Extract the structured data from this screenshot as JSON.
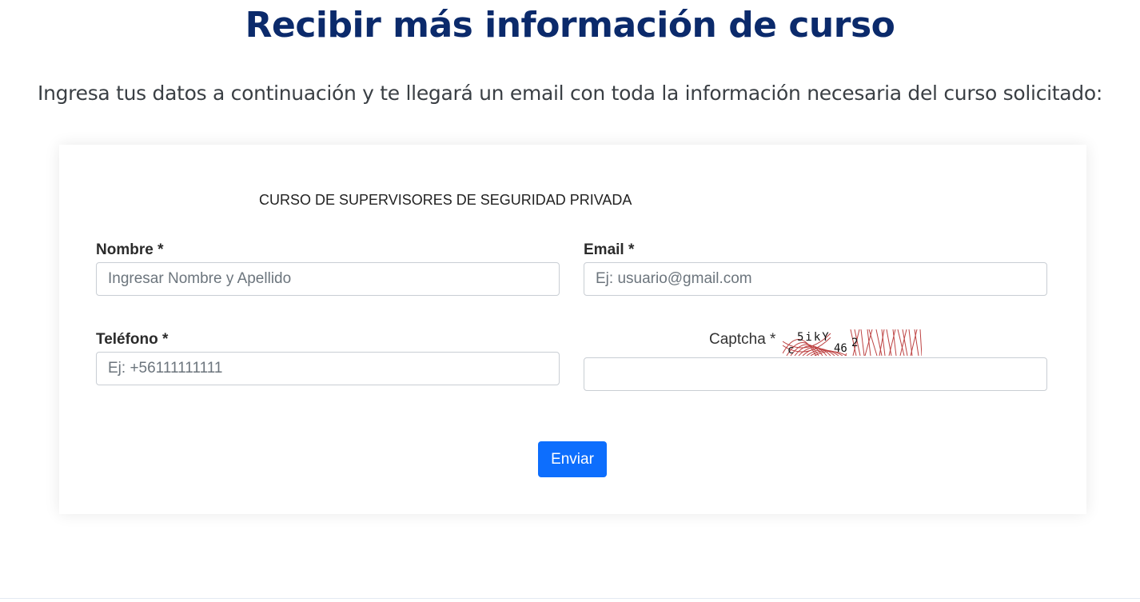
{
  "page": {
    "title": "Recibir más información de curso",
    "subtitle": "Ingresa tus datos a continuación y te llegará un email con toda la información necesaria del curso solicitado:"
  },
  "form": {
    "course_name": "CURSO DE SUPERVISORES DE SEGURIDAD PRIVADA",
    "name_label": "Nombre *",
    "name_value": "",
    "name_placeholder": "Ingresar Nombre y Apellido",
    "email_label": "Email *",
    "email_value": "",
    "email_placeholder": "Ej: usuario@gmail.com",
    "phone_label": "Teléfono *",
    "phone_value": "",
    "phone_placeholder": "Ej: +56111111111",
    "captcha_label": "Captcha *",
    "captcha_text": "c5ikY462",
    "captcha_value": "",
    "submit_label": "Enviar"
  },
  "colors": {
    "title": "#0b2a6b",
    "button": "#0d6efd",
    "captcha_noise": "#b22222"
  }
}
